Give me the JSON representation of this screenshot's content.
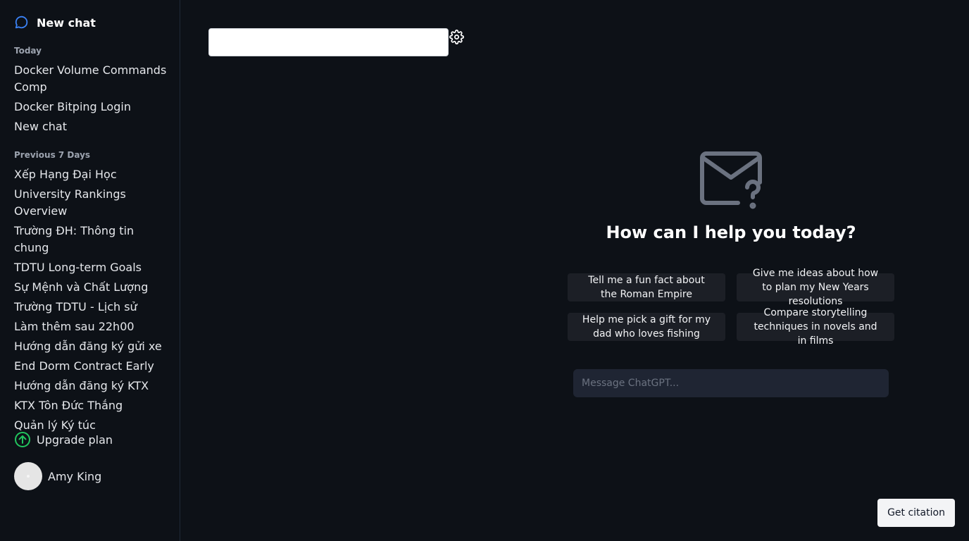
{
  "sidebar": {
    "new_chat_label": "New chat",
    "sections": [
      {
        "title": "Today",
        "items": [
          "Docker Volume Commands Comp",
          "Docker Bitping Login",
          "New chat"
        ]
      },
      {
        "title": "Previous 7 Days",
        "items": [
          "Xếp Hạng Đại Học",
          "University Rankings Overview",
          "Trường ĐH: Thông tin chung",
          "TDTU Long-term Goals",
          "Sự Mệnh và Chất Lượng",
          "Trường TDTU - Lịch sử",
          "Làm thêm sau 22h00",
          "Hướng dẫn đăng ký gửi xe",
          "End Dorm Contract Early",
          "Hướng dẫn đăng ký KTX",
          "KTX Tôn Đức Thắng",
          "Quản lý Ký túc"
        ]
      }
    ],
    "upgrade_label": "Upgrade plan",
    "user_name": "Amy King"
  },
  "top": {
    "search_value": "",
    "settings_icon": "gear-icon"
  },
  "main": {
    "hero_icon": "mail-question-icon",
    "title": "How can I help you today?",
    "suggestions": [
      "Tell me a fun fact about the Roman Empire",
      "Give me ideas about how to plan my New Years resolutions",
      "Help me pick a gift for my dad who loves fishing",
      "Compare storytelling techniques in novels and in films"
    ],
    "message_placeholder": "Message ChatGPT..."
  },
  "citation_label": "Get citation",
  "colors": {
    "background": "#0d1117",
    "accent_blue": "#3b82f6",
    "accent_green": "#22c55e",
    "suggestion_bg": "#1c1f26",
    "input_bg": "#1f2533"
  }
}
